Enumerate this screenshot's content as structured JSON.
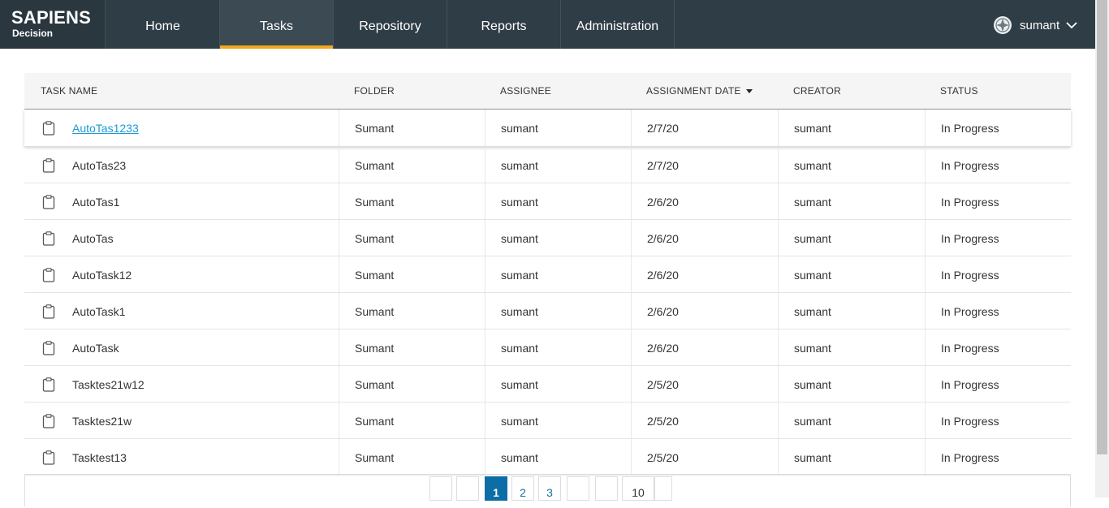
{
  "brand": {
    "line1": "SAPIENS",
    "line2": "Decision"
  },
  "nav": {
    "tabs": [
      {
        "label": "Home"
      },
      {
        "label": "Tasks"
      },
      {
        "label": "Repository"
      },
      {
        "label": "Reports"
      },
      {
        "label": "Administration"
      }
    ],
    "active_index": 1
  },
  "user": {
    "name": "sumant",
    "icon": "globe-icon"
  },
  "table": {
    "columns": [
      "TASK NAME",
      "FOLDER",
      "ASSIGNEE",
      "ASSIGNMENT DATE",
      "CREATOR",
      "STATUS"
    ],
    "sorted_column": "ASSIGNMENT DATE",
    "sort_direction": "descending",
    "rows": [
      {
        "name": "AutoTas1233",
        "folder": "Sumant",
        "assignee": "sumant",
        "date": "2/7/20",
        "creator": "sumant",
        "status": "In Progress"
      },
      {
        "name": "AutoTas23",
        "folder": "Sumant",
        "assignee": "sumant",
        "date": "2/7/20",
        "creator": "sumant",
        "status": "In Progress"
      },
      {
        "name": "AutoTas1",
        "folder": "Sumant",
        "assignee": "sumant",
        "date": "2/6/20",
        "creator": "sumant",
        "status": "In Progress"
      },
      {
        "name": "AutoTas",
        "folder": "Sumant",
        "assignee": "sumant",
        "date": "2/6/20",
        "creator": "sumant",
        "status": "In Progress"
      },
      {
        "name": "AutoTask12",
        "folder": "Sumant",
        "assignee": "sumant",
        "date": "2/6/20",
        "creator": "sumant",
        "status": "In Progress"
      },
      {
        "name": "AutoTask1",
        "folder": "Sumant",
        "assignee": "sumant",
        "date": "2/6/20",
        "creator": "sumant",
        "status": "In Progress"
      },
      {
        "name": "AutoTask",
        "folder": "Sumant",
        "assignee": "sumant",
        "date": "2/6/20",
        "creator": "sumant",
        "status": "In Progress"
      },
      {
        "name": "Tasktes21w12",
        "folder": "Sumant",
        "assignee": "sumant",
        "date": "2/5/20",
        "creator": "sumant",
        "status": "In Progress"
      },
      {
        "name": "Tasktes21w",
        "folder": "Sumant",
        "assignee": "sumant",
        "date": "2/5/20",
        "creator": "sumant",
        "status": "In Progress"
      },
      {
        "name": "Tasktest13",
        "folder": "Sumant",
        "assignee": "sumant",
        "date": "2/5/20",
        "creator": "sumant",
        "status": "In Progress"
      }
    ]
  },
  "pagination": {
    "pages": [
      "1",
      "2",
      "3"
    ],
    "current": "1",
    "page_size": "10"
  },
  "colors": {
    "topbar": "#2f3d46",
    "accent": "#f0a81c",
    "link": "#1a9ad6",
    "page_active": "#0d6da6"
  }
}
